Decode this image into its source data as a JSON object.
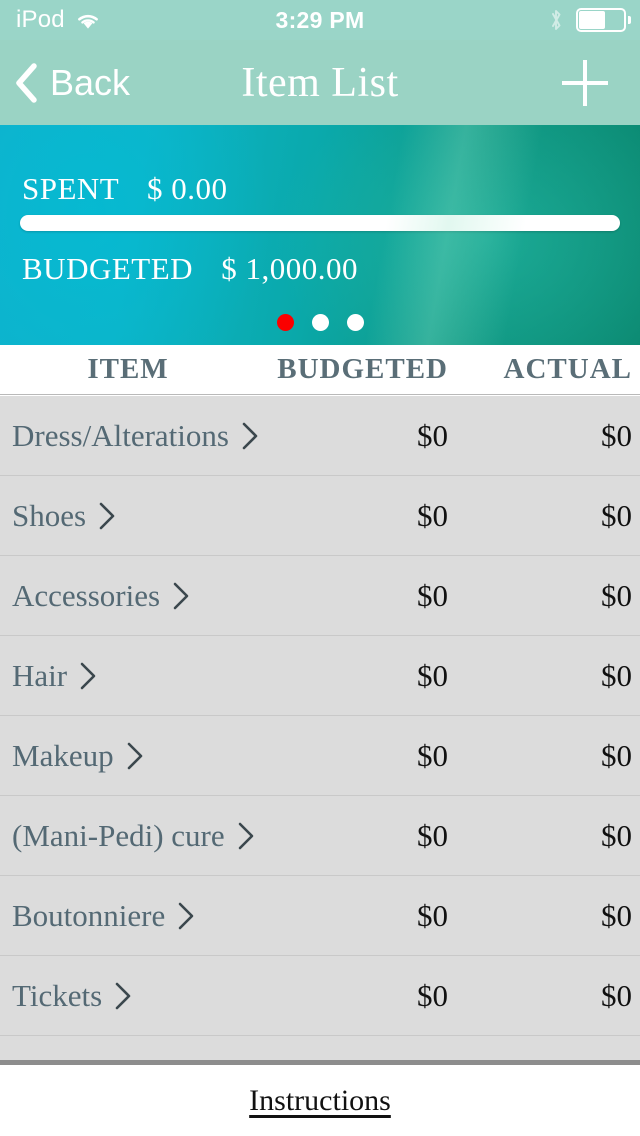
{
  "status_bar": {
    "carrier": "iPod",
    "time": "3:29 PM",
    "wifi_icon": "wifi-icon",
    "bluetooth_icon": "bluetooth-icon",
    "battery_icon": "battery-icon",
    "battery_level_percent": 58
  },
  "nav": {
    "back_label": "Back",
    "back_icon": "chevron-left-icon",
    "title": "Item List",
    "add_icon": "plus-icon",
    "background_color": "#9ad3c4"
  },
  "banner": {
    "spent_label": "SPENT",
    "spent_amount": "$ 0.00",
    "budgeted_label": "BUDGETED",
    "budgeted_amount": "$ 1,000.00",
    "progress_percent": 0,
    "progress_track_color": "#ffffff",
    "gradient_from": "#0fb2cd",
    "gradient_to": "#0c8a72",
    "page_dots": [
      {
        "active": true,
        "color": "#fb0000"
      },
      {
        "active": false,
        "color": "#ffffff"
      },
      {
        "active": false,
        "color": "#ffffff"
      }
    ]
  },
  "table": {
    "columns": [
      "ITEM",
      "BUDGETED",
      "ACTUAL"
    ],
    "header_text_color": "#5a6e77",
    "row_disclosure_icon": "chevron-right-icon",
    "rows": [
      {
        "item": "Dress/Alterations",
        "budgeted": "$0",
        "actual": "$0"
      },
      {
        "item": "Shoes",
        "budgeted": "$0",
        "actual": "$0"
      },
      {
        "item": "Accessories",
        "budgeted": "$0",
        "actual": "$0"
      },
      {
        "item": "Hair",
        "budgeted": "$0",
        "actual": "$0"
      },
      {
        "item": "Makeup",
        "budgeted": "$0",
        "actual": "$0"
      },
      {
        "item": "(Mani-Pedi) cure",
        "budgeted": "$0",
        "actual": "$0"
      },
      {
        "item": "Boutonniere",
        "budgeted": "$0",
        "actual": "$0"
      },
      {
        "item": "Tickets",
        "budgeted": "$0",
        "actual": "$0"
      },
      {
        "item": "",
        "budgeted": "",
        "actual": ""
      }
    ]
  },
  "footer": {
    "instructions_label": "Instructions"
  }
}
